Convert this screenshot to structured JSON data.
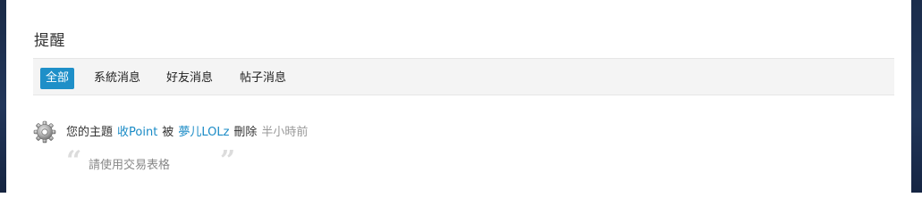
{
  "page": {
    "title": "提醒"
  },
  "tabs": [
    {
      "label": "全部",
      "active": true
    },
    {
      "label": "系統消息",
      "active": false
    },
    {
      "label": "好友消息",
      "active": false
    },
    {
      "label": "帖子消息",
      "active": false
    }
  ],
  "notifications": [
    {
      "icon": "gear-icon",
      "prefix": "您的主題",
      "subject": "收Point",
      "middle": "被",
      "actor": "夢儿LOLz",
      "action": "刪除",
      "time": "半小時前",
      "quote": "請使用交易表格"
    }
  ],
  "colors": {
    "accent": "#1e8fc8",
    "link": "#1a8bc6",
    "muted": "#999999",
    "tabbar_bg": "#f4f4f4"
  }
}
